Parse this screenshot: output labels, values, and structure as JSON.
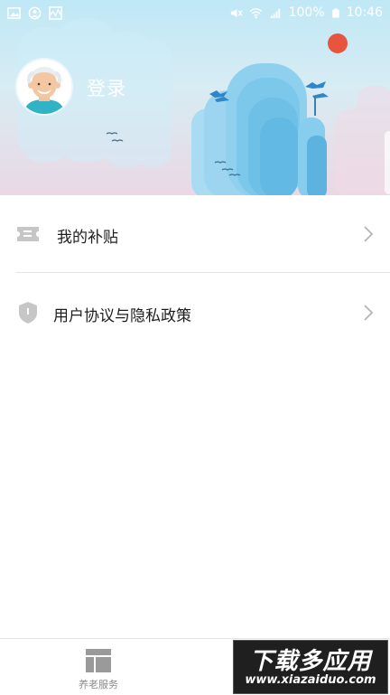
{
  "status_bar": {
    "battery_percent": "100%",
    "time": "10:46",
    "left_icons": [
      "image-icon",
      "account-circle-icon",
      "activity-icon"
    ],
    "right_icons": [
      "mute-icon",
      "wifi-icon",
      "signal-icon",
      "battery-icon"
    ]
  },
  "header": {
    "login_label": "登录",
    "avatar_icon": "elder-avatar-icon"
  },
  "menu": {
    "items": [
      {
        "label": "我的补贴",
        "icon": "ticket-icon"
      },
      {
        "label": "用户协议与隐私政策",
        "icon": "shield-icon"
      }
    ]
  },
  "bottom_nav": {
    "items": [
      {
        "label": "养老服务",
        "icon": "layout-icon"
      }
    ]
  },
  "watermark": {
    "title": "下载多应用",
    "url": "www.xiazaiduo.com"
  },
  "colors": {
    "banner_top": "#bfe8f6",
    "banner_bottom": "#ead8e4",
    "sun": "#e8553f",
    "mountain": "#7cc8ea"
  }
}
